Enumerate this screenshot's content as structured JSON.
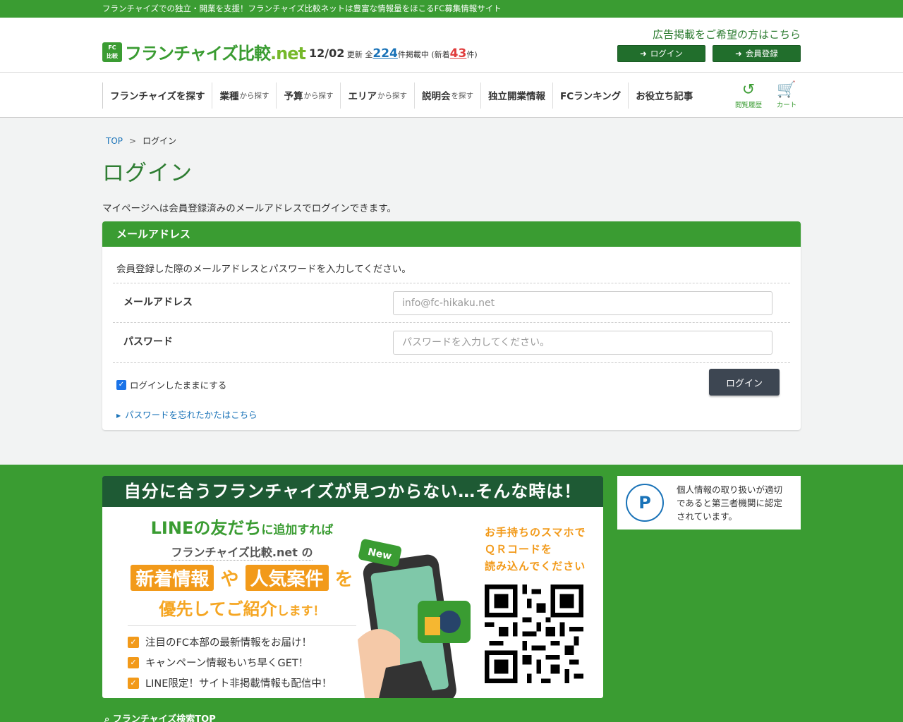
{
  "tagline": "フランチャイズでの独立・開業を支援！フランチャイズ比較ネットは豊富な情報量をほこるFC募集情報サイト",
  "header": {
    "logo_badge_top": "FC",
    "logo_badge_bottom": "比較",
    "logo_main": "フランチャイズ比較",
    "logo_suffix": ".net",
    "update_date": "12/02",
    "update_label": "更新 全",
    "total_count": "224",
    "listing_label": "件掲載中 (新着",
    "new_count": "43",
    "new_suffix": "件)",
    "ad_link": "広告掲載をご希望の方はこちら",
    "login_button": "ログイン",
    "register_button": "会員登録"
  },
  "nav": {
    "items": [
      {
        "main": "フランチャイズを探す",
        "sub": ""
      },
      {
        "main": "業種",
        "sub": "から探す"
      },
      {
        "main": "予算",
        "sub": "から探す"
      },
      {
        "main": "エリア",
        "sub": "から探す"
      },
      {
        "main": "説明会",
        "sub": "を探す"
      },
      {
        "main": "独立開業情報",
        "sub": ""
      },
      {
        "main": "FCランキング",
        "sub": ""
      },
      {
        "main": "お役立ち記事",
        "sub": ""
      }
    ],
    "history_label": "閲覧履歴",
    "cart_label": "カート"
  },
  "breadcrumb": {
    "top": "TOP",
    "separator": ">",
    "current": "ログイン"
  },
  "page": {
    "title": "ログイン",
    "intro": "マイページへは会員登録済みのメールアドレスでログインできます。"
  },
  "login_card": {
    "header": "メールアドレス",
    "description": "会員登録した際のメールアドレスとパスワードを入力してください。",
    "email_label": "メールアドレス",
    "email_placeholder": "info@fc-hikaku.net",
    "password_label": "パスワード",
    "password_placeholder": "パスワードを入力してください。",
    "remember_label": "ログインしたままにする",
    "remember_checked": true,
    "submit_label": "ログイン",
    "forgot_link": "パスワードを忘れたかたはこちら"
  },
  "line_banner": {
    "heading": "自分に合うフランチャイズが見つからない…そんな時は！",
    "line1_main": "LINEの友だち",
    "line1_sub": "に追加すれば",
    "line2": "フランチャイズ比較.net",
    "line2_sub": "の",
    "pill1": "新着情報",
    "pill_joiner": "や",
    "pill2": "人気案件",
    "pill_suffix": "を",
    "line4_main": "優先してご紹介",
    "line4_sub": "します！",
    "bullets": [
      "注目のFC本部の最新情報をお届け！",
      "キャンペーン情報もいち早くGET！",
      "LINE限定！サイト非掲載情報も配信中！"
    ],
    "phone_badge": "New",
    "qr_line1": "お手持ちのスマホで",
    "qr_line2": "ＱＲコードを",
    "qr_line3": "読み込んでください"
  },
  "privacy": {
    "mark": "P",
    "text_line1": "個人情報の取り扱いが適切",
    "text_line2": "であると第三者機関に認定",
    "text_line3": "されています。"
  },
  "footer": {
    "search_link": "フランチャイズ検索TOP"
  },
  "colors": {
    "brand_green": "#3a9c32",
    "dark_green": "#216e2c",
    "link_blue": "#1a73b8",
    "orange": "#f29a1a",
    "submit_dark": "#3d4652"
  }
}
